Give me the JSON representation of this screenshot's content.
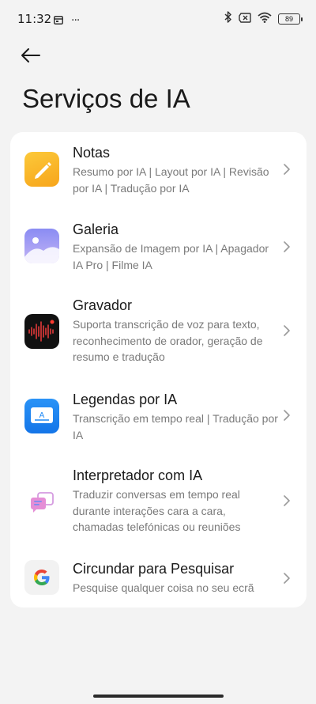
{
  "status_bar": {
    "time": "11:32",
    "more": "···",
    "battery": "89"
  },
  "header": {
    "title": "Serviços de IA"
  },
  "items": [
    {
      "title": "Notas",
      "description": "Resumo por IA | Layout por IA | Revisão por IA | Tradução por IA",
      "icon": "notes-icon"
    },
    {
      "title": "Galeria",
      "description": "Expansão de Imagem por IA | Apagador IA Pro | Filme IA",
      "icon": "gallery-icon"
    },
    {
      "title": "Gravador",
      "description": "Suporta transcrição de voz para texto, reconhecimento de orador, geração de resumo e tradução",
      "icon": "recorder-icon"
    },
    {
      "title": "Legendas por IA",
      "description": "Transcrição em tempo real | Tradução por IA",
      "icon": "captions-icon"
    },
    {
      "title": "Interpretador com IA",
      "description": "Traduzir conversas em tempo real durante interações cara a cara, chamadas telefónicas ou reuniões",
      "icon": "interpreter-icon"
    },
    {
      "title": "Circundar para Pesquisar",
      "description": "Pesquise qualquer coisa no seu ecrã",
      "icon": "google-icon"
    }
  ],
  "colors": {
    "background": "#f3f3f3",
    "card": "#ffffff",
    "notes_accent": "#fbb829",
    "gallery_accent": "#7d7cf0",
    "captions_accent": "#1e88f5"
  }
}
